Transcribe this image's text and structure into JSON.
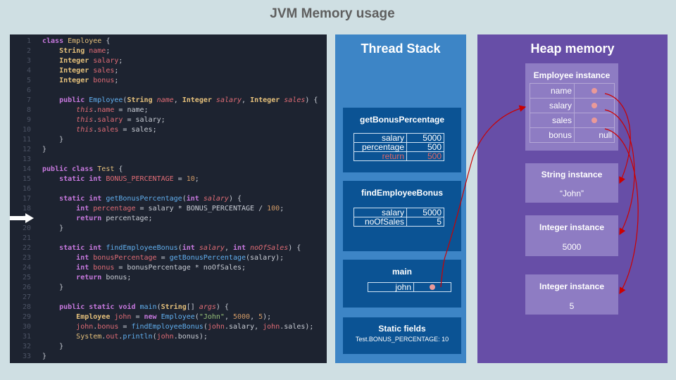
{
  "title": "JVM Memory usage",
  "code_lines": [
    [
      [
        "kw",
        "class "
      ],
      [
        "cls",
        "Employee "
      ],
      [
        "pl",
        "{"
      ]
    ],
    [
      [
        "pl",
        "    "
      ],
      [
        "ty",
        "String "
      ],
      [
        "fld",
        "name"
      ],
      [
        "pl",
        ";"
      ]
    ],
    [
      [
        "pl",
        "    "
      ],
      [
        "ty",
        "Integer "
      ],
      [
        "fld",
        "salary"
      ],
      [
        "pl",
        ";"
      ]
    ],
    [
      [
        "pl",
        "    "
      ],
      [
        "ty",
        "Integer "
      ],
      [
        "fld",
        "sales"
      ],
      [
        "pl",
        ";"
      ]
    ],
    [
      [
        "pl",
        "    "
      ],
      [
        "ty",
        "Integer "
      ],
      [
        "fld",
        "bonus"
      ],
      [
        "pl",
        ";"
      ]
    ],
    [],
    [
      [
        "pl",
        "    "
      ],
      [
        "kw",
        "public "
      ],
      [
        "fn",
        "Employee"
      ],
      [
        "pl",
        "("
      ],
      [
        "ty",
        "String "
      ],
      [
        "par",
        "name"
      ],
      [
        "pl",
        ", "
      ],
      [
        "ty",
        "Integer "
      ],
      [
        "par",
        "salary"
      ],
      [
        "pl",
        ", "
      ],
      [
        "ty",
        "Integer "
      ],
      [
        "par",
        "sales"
      ],
      [
        "pl",
        ") {"
      ]
    ],
    [
      [
        "pl",
        "        "
      ],
      [
        "par",
        "this"
      ],
      [
        "pl",
        "."
      ],
      [
        "fld",
        "name"
      ],
      [
        "pl",
        " = name;"
      ]
    ],
    [
      [
        "pl",
        "        "
      ],
      [
        "par",
        "this"
      ],
      [
        "pl",
        "."
      ],
      [
        "fld",
        "salary"
      ],
      [
        "pl",
        " = salary;"
      ]
    ],
    [
      [
        "pl",
        "        "
      ],
      [
        "par",
        "this"
      ],
      [
        "pl",
        "."
      ],
      [
        "fld",
        "sales"
      ],
      [
        "pl",
        " = sales;"
      ]
    ],
    [
      [
        "pl",
        "    }"
      ]
    ],
    [
      [
        "pl",
        "}"
      ]
    ],
    [],
    [
      [
        "kw",
        "public class "
      ],
      [
        "cls",
        "Test "
      ],
      [
        "pl",
        "{"
      ]
    ],
    [
      [
        "pl",
        "    "
      ],
      [
        "kw",
        "static int "
      ],
      [
        "fld",
        "BONUS_PERCENTAGE"
      ],
      [
        "pl",
        " = "
      ],
      [
        "num",
        "10"
      ],
      [
        "pl",
        ";"
      ]
    ],
    [],
    [
      [
        "pl",
        "    "
      ],
      [
        "kw",
        "static int "
      ],
      [
        "fn",
        "getBonusPercentage"
      ],
      [
        "pl",
        "("
      ],
      [
        "kw",
        "int "
      ],
      [
        "par",
        "salary"
      ],
      [
        "pl",
        ") {"
      ]
    ],
    [
      [
        "pl",
        "        "
      ],
      [
        "kw",
        "int "
      ],
      [
        "fld",
        "percentage"
      ],
      [
        "pl",
        " = salary * BONUS_PERCENTAGE / "
      ],
      [
        "num",
        "100"
      ],
      [
        "pl",
        ";"
      ]
    ],
    [
      [
        "pl",
        "        "
      ],
      [
        "kw",
        "return "
      ],
      [
        "pl",
        "percentage;"
      ]
    ],
    [
      [
        "pl",
        "    }"
      ]
    ],
    [],
    [
      [
        "pl",
        "    "
      ],
      [
        "kw",
        "static int "
      ],
      [
        "fn",
        "findEmployeeBonus"
      ],
      [
        "pl",
        "("
      ],
      [
        "kw",
        "int "
      ],
      [
        "par",
        "salary"
      ],
      [
        "pl",
        ", "
      ],
      [
        "kw",
        "int "
      ],
      [
        "par",
        "noOfSales"
      ],
      [
        "pl",
        ") {"
      ]
    ],
    [
      [
        "pl",
        "        "
      ],
      [
        "kw",
        "int "
      ],
      [
        "fld",
        "bonusPercentage"
      ],
      [
        "pl",
        " = "
      ],
      [
        "fn",
        "getBonusPercentage"
      ],
      [
        "pl",
        "(salary);"
      ]
    ],
    [
      [
        "pl",
        "        "
      ],
      [
        "kw",
        "int "
      ],
      [
        "fld",
        "bonus"
      ],
      [
        "pl",
        " = bonusPercentage * noOfSales;"
      ]
    ],
    [
      [
        "pl",
        "        "
      ],
      [
        "kw",
        "return "
      ],
      [
        "pl",
        "bonus;"
      ]
    ],
    [
      [
        "pl",
        "    }"
      ]
    ],
    [],
    [
      [
        "pl",
        "    "
      ],
      [
        "kw",
        "public static void "
      ],
      [
        "fn",
        "main"
      ],
      [
        "pl",
        "("
      ],
      [
        "ty",
        "String"
      ],
      [
        "pl",
        "[] "
      ],
      [
        "par",
        "args"
      ],
      [
        "pl",
        ") {"
      ]
    ],
    [
      [
        "pl",
        "        "
      ],
      [
        "ty",
        "Employee "
      ],
      [
        "fld",
        "john"
      ],
      [
        "pl",
        " = "
      ],
      [
        "kw",
        "new "
      ],
      [
        "fn",
        "Employee"
      ],
      [
        "pl",
        "("
      ],
      [
        "str",
        "\"John\""
      ],
      [
        "pl",
        ", "
      ],
      [
        "num",
        "5000"
      ],
      [
        "pl",
        ", "
      ],
      [
        "num",
        "5"
      ],
      [
        "pl",
        ");"
      ]
    ],
    [
      [
        "pl",
        "        "
      ],
      [
        "fld",
        "john"
      ],
      [
        "pl",
        "."
      ],
      [
        "fld",
        "bonus"
      ],
      [
        "pl",
        " = "
      ],
      [
        "fn",
        "findEmployeeBonus"
      ],
      [
        "pl",
        "("
      ],
      [
        "fld",
        "john"
      ],
      [
        "pl",
        ".salary, "
      ],
      [
        "fld",
        "john"
      ],
      [
        "pl",
        ".sales);"
      ]
    ],
    [
      [
        "pl",
        "        "
      ],
      [
        "cls",
        "System"
      ],
      [
        "pl",
        "."
      ],
      [
        "fld",
        "out"
      ],
      [
        "pl",
        "."
      ],
      [
        "fn",
        "println"
      ],
      [
        "pl",
        "("
      ],
      [
        "fld",
        "john"
      ],
      [
        "pl",
        ".bonus);"
      ]
    ],
    [
      [
        "pl",
        "    }"
      ]
    ],
    [
      [
        "pl",
        "}"
      ]
    ]
  ],
  "thread_stack": {
    "title": "Thread Stack",
    "frames": [
      {
        "name": "getBonusPercentage",
        "vars": [
          {
            "name": "salary",
            "value": "5000",
            "style": "normal"
          },
          {
            "name": "percentage",
            "value": "500",
            "style": "normal"
          },
          {
            "name": "return",
            "value": "500",
            "style": "return"
          }
        ]
      },
      {
        "name": "findEmployeeBonus",
        "vars": [
          {
            "name": "salary",
            "value": "5000",
            "style": "normal"
          },
          {
            "name": "noOfSales",
            "value": "5",
            "style": "normal"
          }
        ]
      },
      {
        "name": "main",
        "vars": [
          {
            "name": "john",
            "value": "",
            "style": "ref"
          }
        ]
      }
    ],
    "static_fields": {
      "title": "Static fields",
      "text": "Test.BONUS_PERCENTAGE: 10"
    }
  },
  "heap": {
    "title": "Heap memory",
    "employee": {
      "title": "Employee instance",
      "fields": [
        {
          "name": "name",
          "value": "",
          "style": "ref"
        },
        {
          "name": "salary",
          "value": "",
          "style": "ref"
        },
        {
          "name": "sales",
          "value": "",
          "style": "ref"
        },
        {
          "name": "bonus",
          "value": "null",
          "style": "normal"
        }
      ]
    },
    "instances": [
      {
        "title": "String instance",
        "value": "“John”"
      },
      {
        "title": "Integer instance",
        "value": "5000"
      },
      {
        "title": "Integer instance",
        "value": "5"
      }
    ]
  },
  "colors": {
    "code_background": "#1d2330",
    "stack_panel": "#3d85c6",
    "stack_frame": "#0b5394",
    "heap_panel": "#674ea7",
    "heap_instance": "#8e7cc3",
    "reference_arrow": "#cc0000",
    "reference_dot": "#ea9999"
  },
  "current_line_indicator": "arrow-right-icon"
}
